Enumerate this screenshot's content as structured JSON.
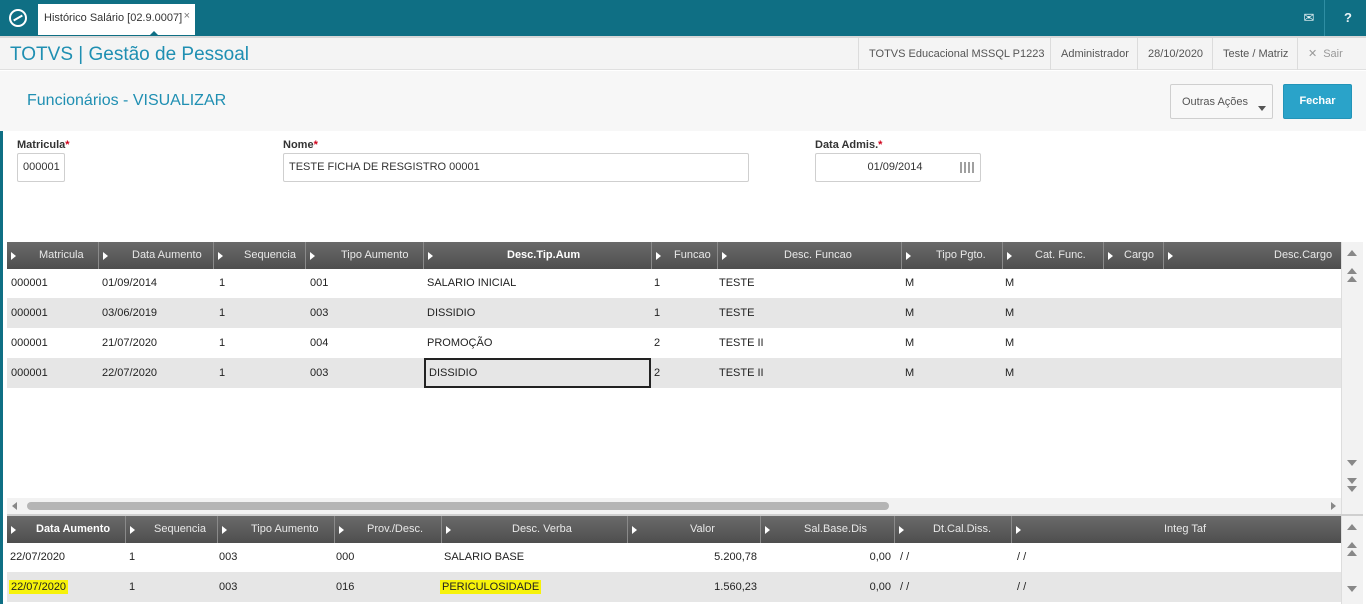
{
  "topbar": {
    "tab_label": "Histórico Salário [02.9.0007]",
    "tab_close": "×",
    "mail_icon": "✉",
    "help_icon": "?"
  },
  "header": {
    "title": "TOTVS | Gestão de Pessoal",
    "database": "TOTVS Educacional MSSQL P1223",
    "user": "Administrador",
    "date": "28/10/2020",
    "branch": "Teste / Matriz",
    "exit_icon": "✕",
    "exit_label": "Sair"
  },
  "page": {
    "title": "Funcionários - VISUALIZAR",
    "outras_acoes": "Outras Ações",
    "fechar": "Fechar"
  },
  "form": {
    "matricula_label": "Matricula",
    "matricula_value": "000001",
    "nome_label": "Nome",
    "nome_value": "TESTE FICHA DE RESGISTRO 00001",
    "data_admis_label": "Data Admis.",
    "data_admis_value": "01/09/2014",
    "required_mark": "*"
  },
  "grid1": {
    "columns": [
      "Matricula",
      "Data Aumento",
      "Sequencia",
      "Tipo Aumento",
      "Desc.Tip.Aum",
      "Funcao",
      "Desc. Funcao",
      "Tipo Pgto.",
      "Cat. Func.",
      "Cargo",
      "Desc.Cargo"
    ],
    "rows": [
      [
        "000001",
        "01/09/2014",
        "1",
        "001",
        "SALARIO INICIAL",
        "1",
        "TESTE",
        "M",
        "M",
        "",
        ""
      ],
      [
        "000001",
        "03/06/2019",
        "1",
        "003",
        "DISSIDIO",
        "1",
        "TESTE",
        "M",
        "M",
        "",
        ""
      ],
      [
        "000001",
        "21/07/2020",
        "1",
        "004",
        "PROMOÇÃO",
        "2",
        "TESTE II",
        "M",
        "M",
        "",
        ""
      ],
      [
        "000001",
        "22/07/2020",
        "1",
        "003",
        "DISSIDIO",
        "2",
        "TESTE II",
        "M",
        "M",
        "",
        ""
      ]
    ]
  },
  "grid2": {
    "columns": [
      "Data Aumento",
      "Sequencia",
      "Tipo Aumento",
      "Prov./Desc.",
      "Desc. Verba",
      "Valor",
      "Sal.Base.Dis",
      "Dt.Cal.Diss.",
      "Integ Taf"
    ],
    "rows": [
      [
        "22/07/2020",
        "1",
        "003",
        "000",
        "SALARIO BASE",
        "5.200,78",
        "0,00",
        " /  /",
        " /  /"
      ],
      [
        "22/07/2020",
        "1",
        "003",
        "016",
        "PERICULOSIDADE",
        "1.560,23",
        "0,00",
        " /  /",
        " /  /"
      ]
    ]
  }
}
